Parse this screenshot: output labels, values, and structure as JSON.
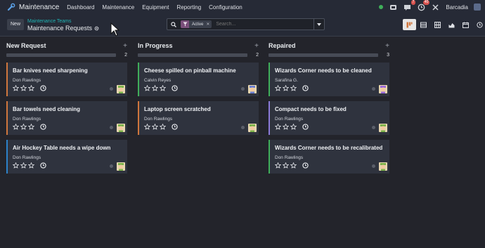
{
  "navbar": {
    "app_name": "Maintenance",
    "menu": [
      "Dashboard",
      "Maintenance",
      "Equipment",
      "Reporting",
      "Configuration"
    ],
    "chat_badge": "7",
    "activity_badge": "40",
    "company": "Barcadia"
  },
  "control_panel": {
    "new_label": "New",
    "breadcrumb_parent": "Maintenance Teams",
    "breadcrumb_current": "Maintenance Requests",
    "facet_label": "Active",
    "search_placeholder": "Search..."
  },
  "colors": {
    "accent_teal": "#1fb4b4",
    "filter_purple": "#7a4f7a",
    "orange": "#d0763c",
    "blue": "#2c82c9",
    "green": "#3fae5a",
    "purple": "#8a7ad8"
  },
  "columns": [
    {
      "title": "New Request",
      "count": "2",
      "cards": [
        {
          "title": "Bar knives need sharpening",
          "assignee": "Don Rawlings",
          "avatar": "don",
          "color": "#d0763c"
        },
        {
          "title": "Bar towels need cleaning",
          "assignee": "Don Rawlings",
          "avatar": "don",
          "color": "#d0763c"
        },
        {
          "title": "Air Hockey Table needs a wipe down",
          "assignee": "Don Rawlings",
          "avatar": "don",
          "color": "#2c82c9"
        }
      ]
    },
    {
      "title": "In Progress",
      "count": "2",
      "cards": [
        {
          "title": "Cheese spilled on pinball machine",
          "assignee": "Calvin Reyes",
          "avatar": "calvin",
          "color": "#3fae5a"
        },
        {
          "title": "Laptop screen scratched",
          "assignee": "Don Rawlings",
          "avatar": "don",
          "color": "#d0763c"
        }
      ]
    },
    {
      "title": "Repaired",
      "count": "3",
      "cards": [
        {
          "title": "Wizards Corner needs to be cleaned",
          "assignee": "Sarafina G.",
          "avatar": "sarafina",
          "color": "#3fae5a"
        },
        {
          "title": "Compact needs to be fixed",
          "assignee": "Don Rawlings",
          "avatar": "don",
          "color": "#8a7ad8"
        },
        {
          "title": "Wizards Corner needs to be recalibrated",
          "assignee": "Don Rawlings",
          "avatar": "don",
          "color": "#3fae5a"
        }
      ]
    }
  ]
}
